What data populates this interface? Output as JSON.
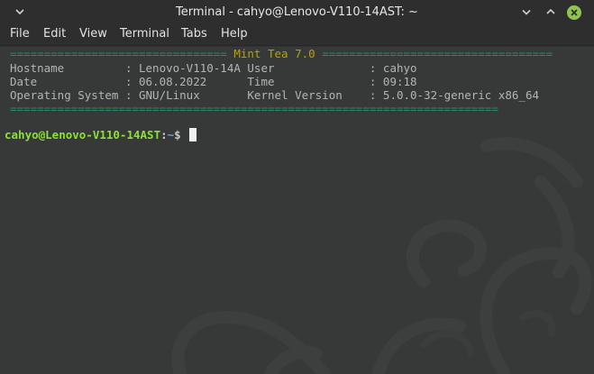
{
  "window": {
    "title": "Terminal - cahyo@Lenovo-V110-14AST: ~"
  },
  "menu": {
    "items": [
      "File",
      "Edit",
      "View",
      "Terminal",
      "Tabs",
      "Help"
    ]
  },
  "banner": {
    "separator_left": "================================",
    "title": "Mint Tea 7.0",
    "separator_right": "==================================",
    "bottom_separator": "========================================================================",
    "rows": [
      {
        "left_label": "Hostname         ",
        "left_value": ": Lenovo-V110-14A",
        "right_label": " User            ",
        "right_value": "  : cahyo"
      },
      {
        "left_label": "Date             ",
        "left_value": ": 06.08.2022     ",
        "right_label": " Time            ",
        "right_value": "  : 09:18"
      },
      {
        "left_label": "Operating System ",
        "left_value": ": GNU/Linux      ",
        "right_label": " Kernel Version  ",
        "right_value": "  : 5.0.0-32-generic x86_64"
      }
    ]
  },
  "prompt": {
    "user_host": "cahyo@Lenovo-V110-14AST",
    "colon": ":",
    "path": "~",
    "symbol": "$"
  },
  "colors": {
    "separator": "#2a8a64",
    "banner_title": "#b5a400",
    "prompt_user": "#8ae234",
    "prompt_path": "#6aa3e8"
  }
}
